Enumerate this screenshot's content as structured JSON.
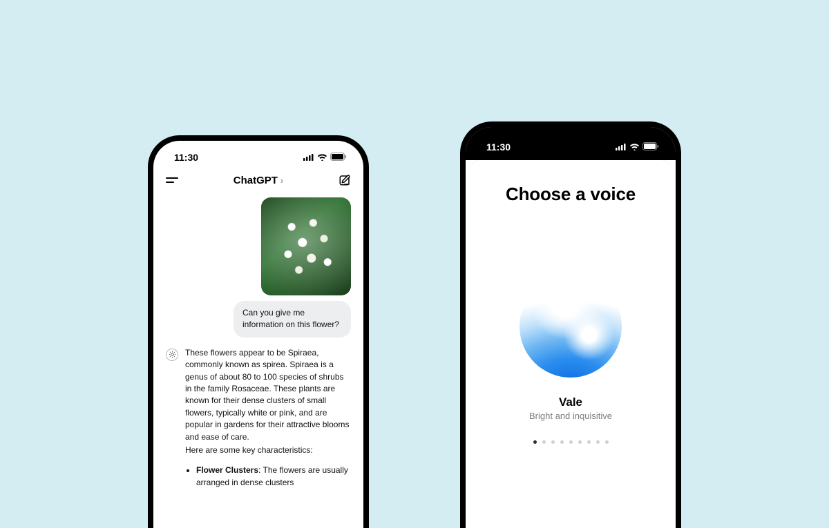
{
  "status": {
    "time": "11:30"
  },
  "left": {
    "header": {
      "title": "ChatGPT"
    },
    "user_message": "Can you give me information on this flower?",
    "assistant": {
      "paragraph": "These flowers appear to be Spiraea, commonly known as spirea. Spiraea is a genus of about 80 to 100 species of shrubs in the family Rosaceae. These plants are known for their dense clusters of small flowers, typically white or pink, and are popular in gardens for their attractive blooms and ease of care.",
      "lead": "Here are some key characteristics:",
      "bullet_title": "Flower Clusters",
      "bullet_body": ": The flowers are usually arranged in dense clusters"
    }
  },
  "right": {
    "title": "Choose a voice",
    "voice_name": "Vale",
    "voice_desc": "Bright and inquisitive",
    "page_count": 9,
    "active_index": 0
  }
}
